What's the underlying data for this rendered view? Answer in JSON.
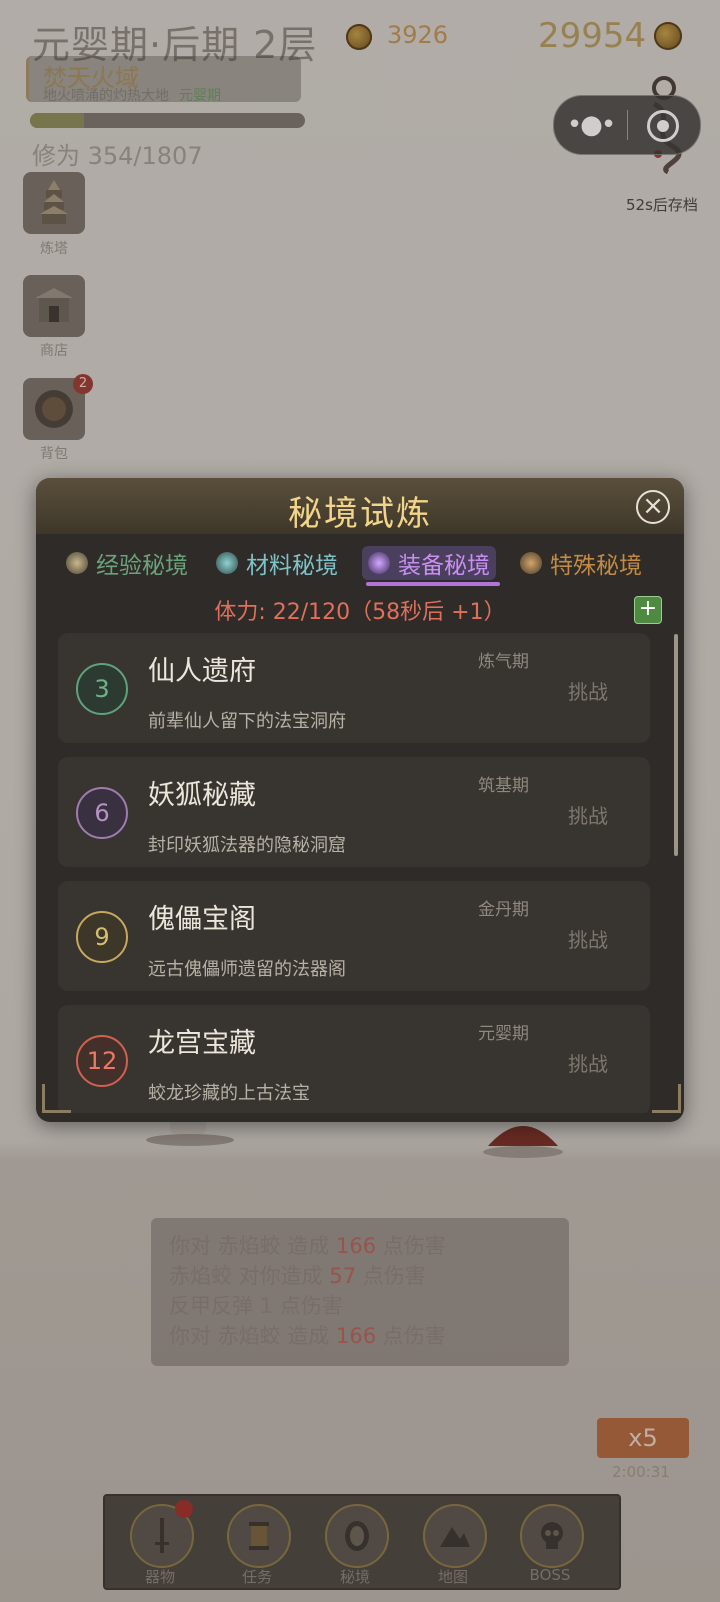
{
  "hud": {
    "realm": "元婴期·后期 2层",
    "spirit_stones": "3926",
    "gold": "29954",
    "zone_name": "焚天火域",
    "zone_desc": "地火喷涌的灼热大地",
    "zone_realm": "元婴期",
    "cultivation": "修为 354/1807",
    "cultivation_progress": 0.196,
    "autosave": "52s后存档"
  },
  "side_menu": [
    {
      "label": "炼塔",
      "icon": "pagoda-icon"
    },
    {
      "label": "商店",
      "icon": "shop-icon"
    },
    {
      "label": "背包",
      "icon": "bag-icon",
      "badge": "2"
    }
  ],
  "modal": {
    "title": "秘境试炼",
    "tabs": [
      {
        "label": "经验秘境",
        "color": "#6aa27a"
      },
      {
        "label": "材料秘境",
        "color": "#7ec3c7"
      },
      {
        "label": "装备秘境",
        "color": "#b06ce0"
      },
      {
        "label": "特殊秘境",
        "color": "#c28a44"
      }
    ],
    "stamina": "体力: 22/120（58秒后 +1）",
    "realms": [
      {
        "level": "3",
        "name": "仙人遗府",
        "desc": "前辈仙人留下的法宝洞府",
        "req": "炼气期",
        "action": "挑战",
        "color": "#5fa27b"
      },
      {
        "level": "6",
        "name": "妖狐秘藏",
        "desc": "封印妖狐法器的隐秘洞窟",
        "req": "筑基期",
        "action": "挑战",
        "color": "#a07bb0"
      },
      {
        "level": "9",
        "name": "傀儡宝阁",
        "desc": "远古傀儡师遗留的法器阁",
        "req": "金丹期",
        "action": "挑战",
        "color": "#c7a85e"
      },
      {
        "level": "12",
        "name": "龙宫宝藏",
        "desc": "蛟龙珍藏的上古法宝",
        "req": "元婴期",
        "action": "挑战",
        "color": "#d0624f"
      }
    ]
  },
  "battle_log": [
    {
      "a": "你对 赤焰蛟 造成 ",
      "n": "166",
      "b": " 点伤害"
    },
    {
      "a": "赤焰蛟 对你造成 ",
      "n": "57",
      "b": " 点伤害"
    },
    {
      "a": "反甲反弹 1 点伤害",
      "n": "",
      "b": ""
    },
    {
      "a": " 你对 赤焰蛟 造成 ",
      "n": "166",
      "b": " 点伤害"
    }
  ],
  "speed": {
    "label": "x5",
    "timer": "2:00:31"
  },
  "bottom_nav": [
    {
      "label": "器物",
      "icon": "sword-icon"
    },
    {
      "label": "任务",
      "icon": "scroll-icon"
    },
    {
      "label": "秘境",
      "icon": "portal-icon"
    },
    {
      "label": "地图",
      "icon": "mountain-icon"
    },
    {
      "label": "BOSS",
      "icon": "skull-icon"
    }
  ]
}
